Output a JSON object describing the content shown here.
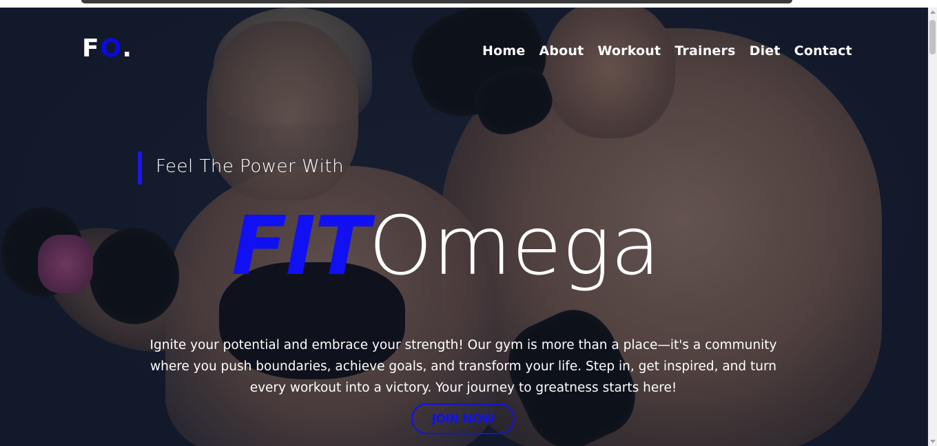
{
  "logo": {
    "letter1": "F",
    "letter2": "O",
    "dot": "."
  },
  "nav": {
    "items": [
      {
        "label": "Home"
      },
      {
        "label": "About"
      },
      {
        "label": "Workout"
      },
      {
        "label": "Trainers"
      },
      {
        "label": "Diet"
      },
      {
        "label": "Contact"
      }
    ]
  },
  "hero": {
    "tagline": "Feel The Power With",
    "headline_accent": "FIT",
    "headline_rest": "Omega",
    "description": "Ignite your potential and embrace your strength! Our gym is more than a place—it's a community where you push boundaries, achieve goals, and transform your life. Step in, get inspired, and turn every workout into a victory. Your journey to greatness starts here!",
    "cta_label": "JOIN NOW"
  },
  "colors": {
    "accent": "#1010f2",
    "background": "#141b2d",
    "text": "#ffffff"
  }
}
